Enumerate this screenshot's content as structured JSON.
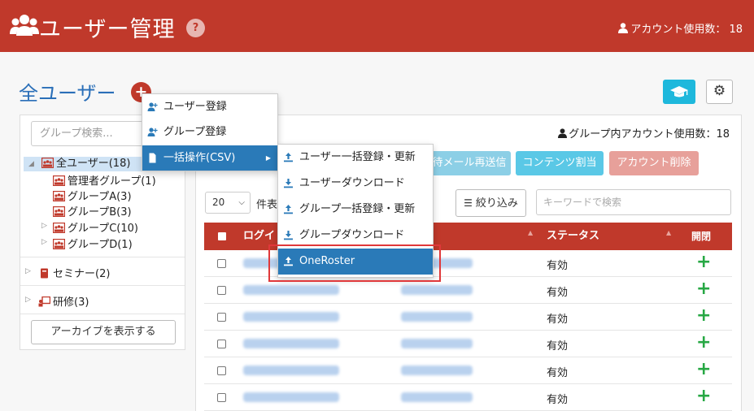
{
  "header": {
    "title": "ユーザー管理",
    "help": "?",
    "account_usage": "アカウント使用数： 18"
  },
  "page": {
    "title": "全ユーザー",
    "add": "+"
  },
  "sidebar": {
    "search_placeholder": "グループ検索...",
    "tree": [
      {
        "label": "全ユーザー(18)"
      },
      {
        "label": "管理者グループ(1)"
      },
      {
        "label": "グループA(3)"
      },
      {
        "label": "グループB(3)"
      },
      {
        "label": "グループC(10)"
      },
      {
        "label": "グループD(1)"
      }
    ],
    "seminar": "セミナー(2)",
    "training": "研修(3)",
    "archive_button": "アーカイブを表示する"
  },
  "main": {
    "group_account_usage": "グループ内アカウント使用数：18",
    "actions": [
      {
        "label": "待メール再送信",
        "color": "#8ccfe6"
      },
      {
        "label": "コンテンツ割当",
        "color": "#5ac8e6"
      },
      {
        "label": "アカウント削除",
        "color": "#e7a09a"
      }
    ],
    "per_page": "20",
    "per_page_suffix": "件表",
    "filter_button": "絞り込み",
    "keyword_placeholder": "キーワードで検索",
    "columns": [
      "ログイ",
      "ステータス",
      "開閉"
    ],
    "rows": [
      {
        "status": "有効"
      },
      {
        "status": "有効"
      },
      {
        "status": "有効"
      },
      {
        "status": "有効"
      },
      {
        "status": "有効"
      },
      {
        "status": "有効"
      }
    ]
  },
  "context_menu": {
    "items": [
      "ユーザー登録",
      "グループ登録",
      "一括操作(CSV)"
    ],
    "submenu": [
      "ユーザー一括登録・更新",
      "ユーザーダウンロード",
      "グループ一括登録・更新",
      "グループダウンロード",
      "OneRoster"
    ]
  },
  "colors": {
    "header": "#c0392b",
    "menu_active": "#2a7ab8",
    "highlight": "#e0383a"
  }
}
